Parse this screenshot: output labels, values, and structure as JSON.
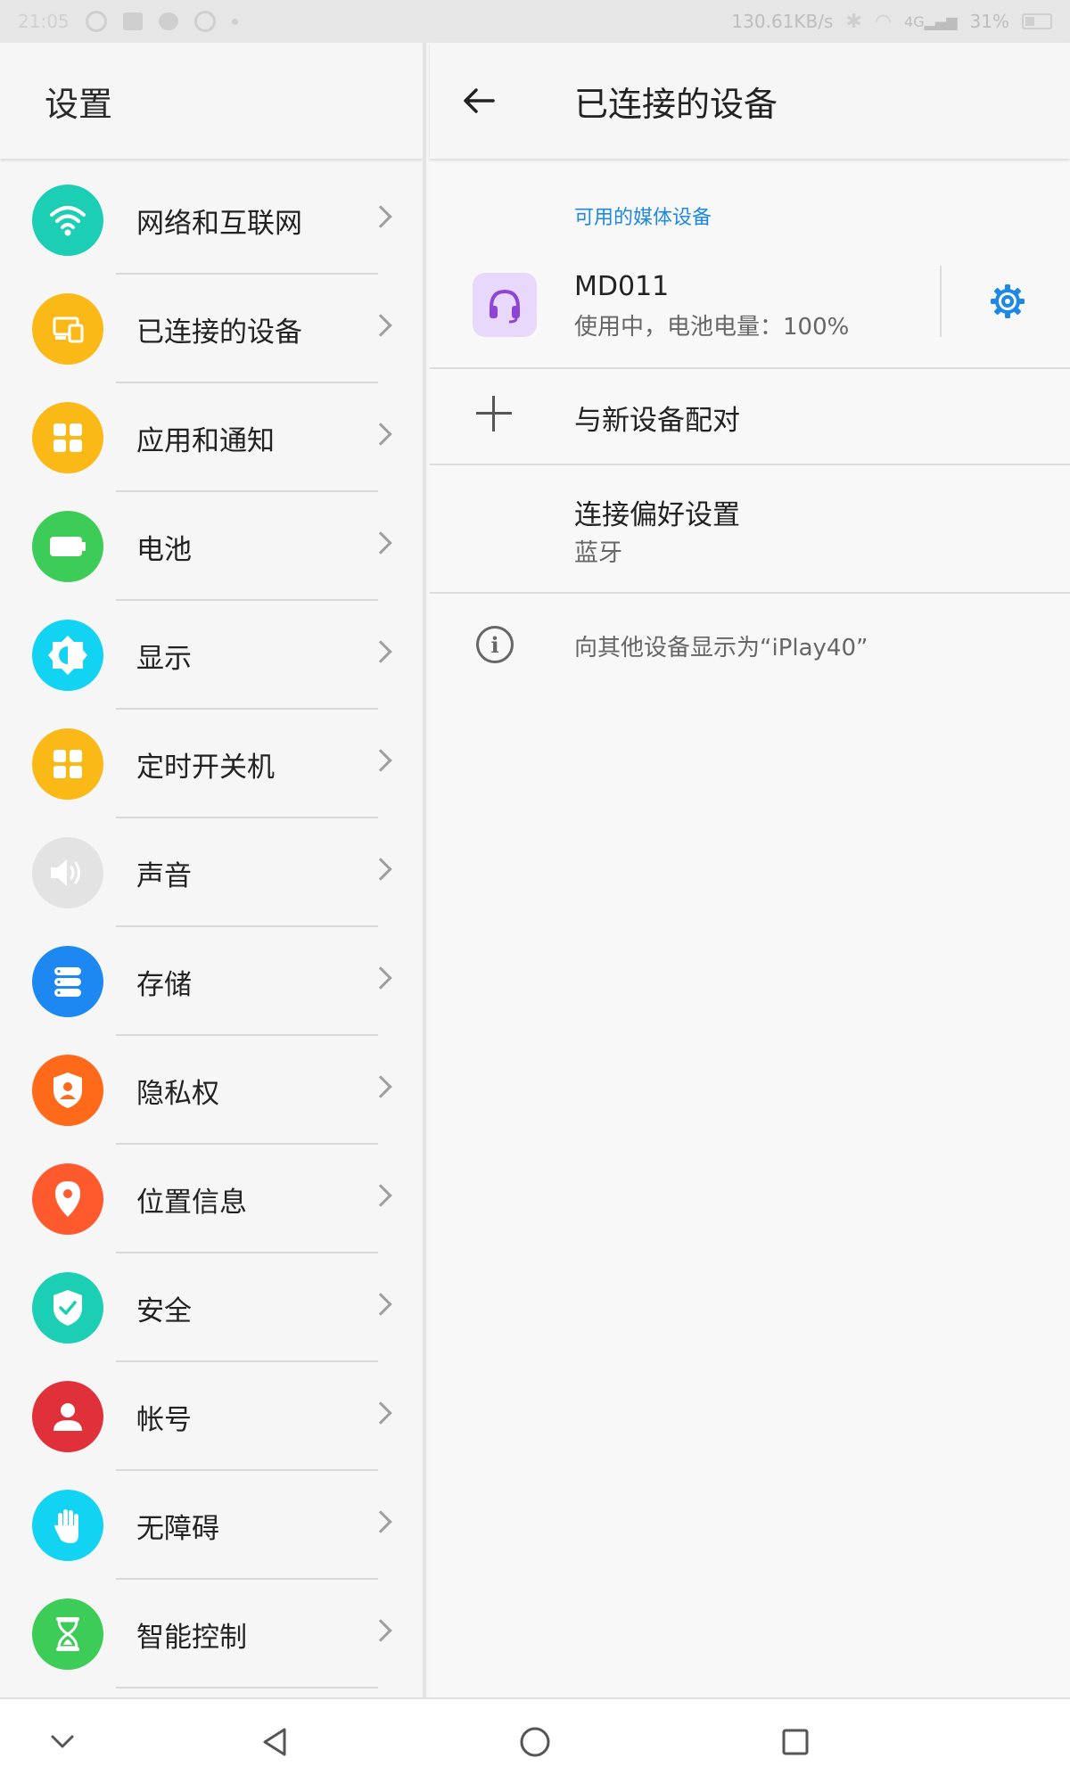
{
  "status_bar": {
    "time": "21:05",
    "network_speed": "130.61KB/s",
    "signal_label": "4G",
    "battery_percent": "31%"
  },
  "left_pane": {
    "title": "设置",
    "items": [
      {
        "label": "网络和互联网",
        "icon": "wifi-icon",
        "color": "#1ccfb4"
      },
      {
        "label": "已连接的设备",
        "icon": "connected-devices-icon",
        "color": "#fbb917"
      },
      {
        "label": "应用和通知",
        "icon": "apps-icon",
        "color": "#fbb917"
      },
      {
        "label": "电池",
        "icon": "battery-icon",
        "color": "#3dcc57"
      },
      {
        "label": "显示",
        "icon": "brightness-icon",
        "color": "#12d4f2"
      },
      {
        "label": "定时开关机",
        "icon": "schedule-power-icon",
        "color": "#fbb917"
      },
      {
        "label": "声音",
        "icon": "sound-icon",
        "color": "#e3e3e3"
      },
      {
        "label": "存储",
        "icon": "storage-icon",
        "color": "#1e88f2"
      },
      {
        "label": "隐私权",
        "icon": "privacy-icon",
        "color": "#ff6a1a"
      },
      {
        "label": "位置信息",
        "icon": "location-icon",
        "color": "#ff5a2e"
      },
      {
        "label": "安全",
        "icon": "security-icon",
        "color": "#1ccfb4"
      },
      {
        "label": "帐号",
        "icon": "account-icon",
        "color": "#e0313a"
      },
      {
        "label": "无障碍",
        "icon": "accessibility-icon",
        "color": "#12d4f2"
      },
      {
        "label": "智能控制",
        "icon": "smart-control-icon",
        "color": "#3dcc57"
      }
    ]
  },
  "right_pane": {
    "title": "已连接的设备",
    "section_label": "可用的媒体设备",
    "device": {
      "name": "MD011",
      "status": "使用中，电池电量：100%"
    },
    "pair_label": "与新设备配对",
    "preferences": {
      "title": "连接偏好设置",
      "subtitle": "蓝牙"
    },
    "visible_as": "向其他设备显示为“iPlay40”"
  },
  "colors": {
    "accent": "#1e88e5",
    "device_icon_bg": "#e8d8fb",
    "device_icon_fg": "#8e44d6"
  }
}
